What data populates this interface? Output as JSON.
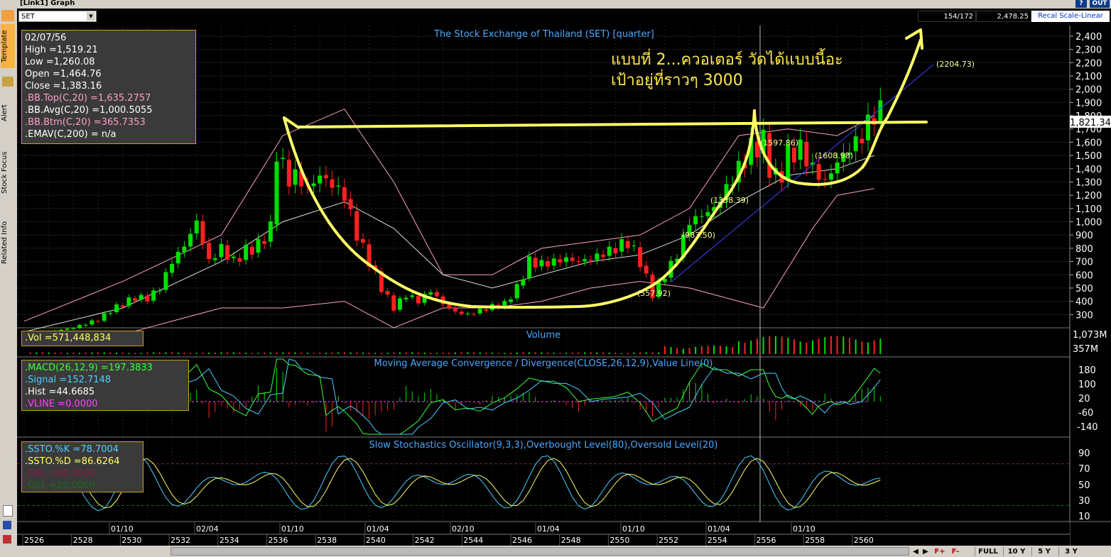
{
  "window": {
    "title": "[Link1] Graph",
    "help_button": "?",
    "out_button": "OUT"
  },
  "sidebar": {
    "tabs": [
      "Template",
      "Alert",
      "Stock Focus",
      "Related Info"
    ]
  },
  "toolbar": {
    "symbol": "SET",
    "count": "154/172",
    "last_value": "2,478.25",
    "recal_label": "Recal Scale-Linear"
  },
  "price_panel": {
    "title": "The Stock Exchange of Thailand (SET) [quarter]",
    "info": {
      "date": "02/07/56",
      "high": "High  =1,519.21",
      "low": "Low  =1,260.08",
      "open": "Open  =1,464.76",
      "close": "Close  =1,383.16",
      "bb_top": ".BB.Top(C,20)  =1,635.2757",
      "bb_avg": ".BB.Avg(C,20)  =1,000.5055",
      "bb_btm": ".BB.Btm(C,20)  =365.7353",
      "emav": ".EMAV(C,200)  = n/a"
    },
    "last_price_tag": "1,821.34",
    "handwritten_line1": "แบบที่  2...ควอเตอร์  วัดได้แบบนี้อะ",
    "handwritten_line2": "เป้าอยู่ที่ราวๆ 3000",
    "annotations": [
      "(2204.73)",
      "(1597.86)",
      "(1608.98)",
      "(1338.39)",
      "(983.50)",
      "(557.92)"
    ],
    "colors": {
      "up": "#00e000",
      "down": "#ff2020",
      "bb_band": "#ff9ec8",
      "bb_avg": "#dddddd",
      "marker": "#ffff66"
    }
  },
  "volume_panel": {
    "title": "Volume",
    "info": ".Vol   =571,448,834",
    "y_ticks": [
      "1,073M",
      "357M"
    ]
  },
  "macd_panel": {
    "title": "Moving Average Convergence / Divergence(CLOSE,26,12,9),Value Line(0)",
    "info": {
      "macd": ".MACD(26,12,9)   =197.3833",
      "signal": ".Signal  =152.7148",
      "hist": ".Hist  =44.6685",
      "vline": ".VLINE   =0.0000"
    },
    "y_ticks": [
      "180",
      "100",
      "20",
      "-60",
      "-140"
    ]
  },
  "stoch_panel": {
    "title": "Slow Stochastics Oscillator(9,3,3),Overbought Level(80),Oversold Level(20)",
    "info": {
      "k": ".SSTO.%K   =78.7004",
      "d": ".SSTO.%D   =86.6264",
      "obl": ".OBL   =80.0000",
      "osl": ".OSL   =20.0000"
    },
    "y_ticks": [
      "90",
      "70",
      "50",
      "30",
      "10"
    ]
  },
  "x_axis": {
    "top_labels": [
      "01/10",
      "02/04",
      "01/10",
      "01/04",
      "02/10",
      "01/04",
      "01/10",
      "01/04",
      "01/10"
    ],
    "bottom_labels": [
      "2526",
      "2528",
      "2530",
      "2532",
      "2534",
      "2536",
      "2538",
      "2540",
      "2542",
      "2544",
      "2546",
      "2548",
      "2550",
      "2552",
      "2554",
      "2556",
      "2558",
      "2560"
    ]
  },
  "bottom_bar": {
    "buttons": [
      "FULL",
      "10 Y",
      "5 Y",
      "3 Y"
    ],
    "zoom": [
      "F+",
      "F-"
    ]
  },
  "chart_data": {
    "type": "candlestick",
    "title": "The Stock Exchange of Thailand (SET) [quarter]",
    "y_ticks": [
      300,
      400,
      500,
      600,
      700,
      800,
      900,
      1000,
      1100,
      1200,
      1300,
      1400,
      1500,
      1600,
      1700,
      1800,
      1900,
      2000,
      2100,
      2200,
      2300,
      2400
    ],
    "ylim": [
      200,
      2480
    ],
    "x_range": [
      "2526",
      "2561"
    ],
    "close_path": [
      [
        2526.0,
        130
      ],
      [
        2527.0,
        170
      ],
      [
        2528.0,
        200
      ],
      [
        2529.0,
        260
      ],
      [
        2529.5,
        330
      ],
      [
        2530.0,
        380
      ],
      [
        2530.5,
        430
      ],
      [
        2531.0,
        420
      ],
      [
        2531.5,
        500
      ],
      [
        2532.0,
        700
      ],
      [
        2532.5,
        820
      ],
      [
        2533.0,
        1000
      ],
      [
        2533.5,
        700
      ],
      [
        2534.0,
        800
      ],
      [
        2534.5,
        700
      ],
      [
        2535.0,
        780
      ],
      [
        2535.5,
        820
      ],
      [
        2536.0,
        950
      ],
      [
        2536.3,
        1650
      ],
      [
        2536.6,
        1300
      ],
      [
        2537.0,
        1350
      ],
      [
        2537.5,
        1250
      ],
      [
        2538.0,
        1350
      ],
      [
        2538.5,
        1280
      ],
      [
        2539.0,
        1200
      ],
      [
        2539.5,
        900
      ],
      [
        2540.0,
        700
      ],
      [
        2540.5,
        500
      ],
      [
        2541.0,
        350
      ],
      [
        2541.5,
        450
      ],
      [
        2542.0,
        400
      ],
      [
        2542.5,
        480
      ],
      [
        2543.0,
        380
      ],
      [
        2543.5,
        320
      ],
      [
        2544.0,
        300
      ],
      [
        2544.5,
        330
      ],
      [
        2545.0,
        360
      ],
      [
        2545.5,
        380
      ],
      [
        2546.0,
        500
      ],
      [
        2546.5,
        700
      ],
      [
        2547.0,
        680
      ],
      [
        2547.5,
        700
      ],
      [
        2548.0,
        720
      ],
      [
        2548.5,
        700
      ],
      [
        2549.0,
        720
      ],
      [
        2549.5,
        760
      ],
      [
        2550.0,
        800
      ],
      [
        2550.5,
        850
      ],
      [
        2551.0,
        700
      ],
      [
        2551.5,
        450
      ],
      [
        2552.0,
        600
      ],
      [
        2552.5,
        750
      ],
      [
        2553.0,
        1000
      ],
      [
        2553.5,
        1050
      ],
      [
        2554.0,
        1100
      ],
      [
        2554.5,
        1250
      ],
      [
        2555.0,
        1400
      ],
      [
        2555.5,
        1550
      ],
      [
        2556.0,
        1600
      ],
      [
        2556.3,
        1380
      ],
      [
        2556.6,
        1300
      ],
      [
        2557.0,
        1500
      ],
      [
        2557.5,
        1550
      ],
      [
        2558.0,
        1400
      ],
      [
        2558.5,
        1300
      ],
      [
        2559.0,
        1450
      ],
      [
        2559.5,
        1550
      ],
      [
        2560.0,
        1650
      ],
      [
        2560.5,
        1820
      ]
    ],
    "bb_top": [
      [
        2526,
        250
      ],
      [
        2530,
        550
      ],
      [
        2534,
        900
      ],
      [
        2536.5,
        1650
      ],
      [
        2539,
        1850
      ],
      [
        2541,
        1300
      ],
      [
        2543,
        600
      ],
      [
        2545,
        600
      ],
      [
        2547,
        800
      ],
      [
        2549,
        850
      ],
      [
        2551,
        900
      ],
      [
        2553,
        1100
      ],
      [
        2555,
        1650
      ],
      [
        2557,
        1700
      ],
      [
        2559,
        1650
      ],
      [
        2560.5,
        1800
      ]
    ],
    "bb_avg": [
      [
        2526,
        170
      ],
      [
        2530,
        350
      ],
      [
        2534,
        700
      ],
      [
        2536.5,
        1000
      ],
      [
        2539,
        1150
      ],
      [
        2541,
        950
      ],
      [
        2543,
        600
      ],
      [
        2545,
        500
      ],
      [
        2547,
        600
      ],
      [
        2549,
        700
      ],
      [
        2551,
        750
      ],
      [
        2553,
        900
      ],
      [
        2555,
        1150
      ],
      [
        2557,
        1350
      ],
      [
        2559,
        1400
      ],
      [
        2560.5,
        1500
      ]
    ],
    "bb_btm": [
      [
        2526,
        120
      ],
      [
        2530,
        150
      ],
      [
        2534,
        350
      ],
      [
        2536.5,
        350
      ],
      [
        2539,
        400
      ],
      [
        2541,
        200
      ],
      [
        2543,
        350
      ],
      [
        2545,
        350
      ],
      [
        2547,
        400
      ],
      [
        2549,
        500
      ],
      [
        2551,
        550
      ],
      [
        2553,
        500
      ],
      [
        2555,
        400
      ],
      [
        2556,
        350
      ],
      [
        2558,
        950
      ],
      [
        2559,
        1200
      ],
      [
        2560.5,
        1250
      ]
    ]
  }
}
